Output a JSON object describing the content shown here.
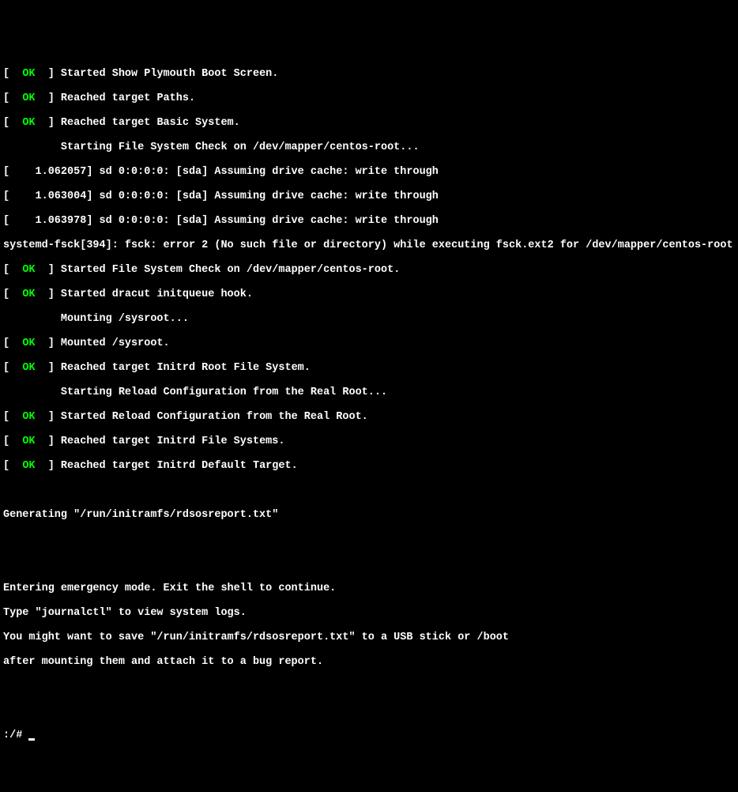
{
  "status_ok": "OK",
  "lines": {
    "l1": "Started Show Plymouth Boot Screen.",
    "l2": "Reached target Paths.",
    "l3": "Reached target Basic System.",
    "l4": "         Starting File System Check on /dev/mapper/centos-root...",
    "l5": "[    1.062057] sd 0:0:0:0: [sda] Assuming drive cache: write through",
    "l6": "[    1.063004] sd 0:0:0:0: [sda] Assuming drive cache: write through",
    "l7": "[    1.063978] sd 0:0:0:0: [sda] Assuming drive cache: write through",
    "l8": "systemd-fsck[394]: fsck: error 2 (No such file or directory) while executing fsck.ext2 for /dev/mapper/centos-root",
    "l9": "Started File System Check on /dev/mapper/centos-root.",
    "l10": "Started dracut initqueue hook.",
    "l11": "         Mounting /sysroot...",
    "l12": "Mounted /sysroot.",
    "l13": "Reached target Initrd Root File System.",
    "l14": "         Starting Reload Configuration from the Real Root...",
    "l15": "Started Reload Configuration from the Real Root.",
    "l16": "Reached target Initrd File Systems.",
    "l17": "Reached target Initrd Default Target.",
    "l18": "Generating \"/run/initramfs/rdsosreport.txt\"",
    "l19": "Entering emergency mode. Exit the shell to continue.",
    "l20": "Type \"journalctl\" to view system logs.",
    "l21": "You might want to save \"/run/initramfs/rdsosreport.txt\" to a USB stick or /boot",
    "l22": "after mounting them and attach it to a bug report.",
    "prompt": ":/# "
  },
  "bracket_open": "[  ",
  "bracket_close": "  ] "
}
